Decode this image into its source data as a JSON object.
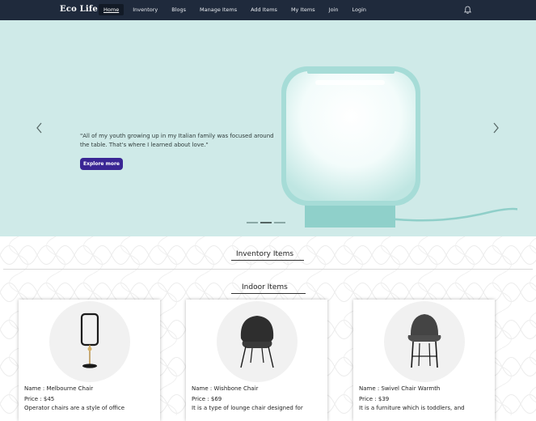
{
  "navbar": {
    "brand": "Eco Life",
    "links": [
      "Home",
      "Inventory",
      "Blogs",
      "Manage Items",
      "Add Items",
      "My Items",
      "Join",
      "Login"
    ],
    "active_index": 0,
    "notification_icon": "bell-icon"
  },
  "hero": {
    "quote": "\"All of my youth growing up in my Italian family was focused around the table. That's where I learned about love.\"",
    "button_label": "Explore more",
    "prev_icon": "chevron-left-icon",
    "next_icon": "chevron-right-icon",
    "slide_count": 3,
    "active_slide": 1,
    "background_color": "#cfeae8",
    "button_color": "#3a2694"
  },
  "sections": {
    "inventory_title": "Inventory Items",
    "indoor_title": "Indoor Items"
  },
  "items": [
    {
      "name": "Name : Melbourne Chair",
      "price": "Price : $45",
      "description": "Operator chairs are a style of office"
    },
    {
      "name": "Name : Wishbone Chair",
      "price": "Price : $69",
      "description": "It is a type of lounge chair designed for"
    },
    {
      "name": "Name : Swivel Chair Warmth",
      "price": "Price : $39",
      "description": "It is a furniture which is toddlers, and"
    }
  ]
}
